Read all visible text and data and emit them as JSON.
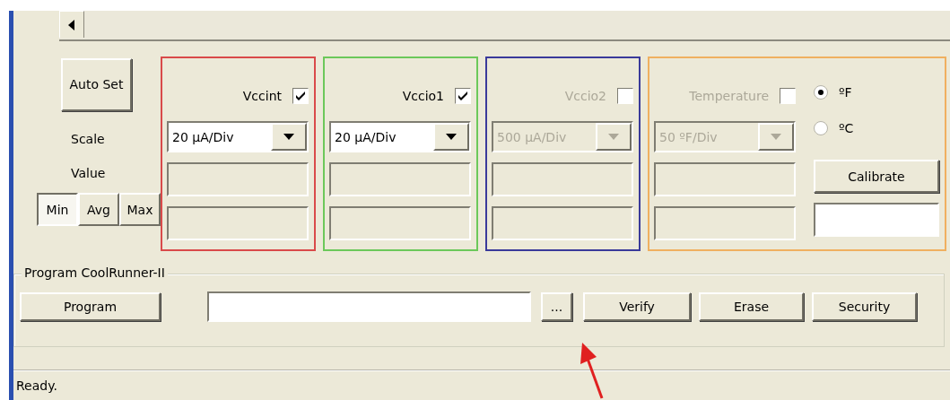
{
  "auto_set_button": "Auto Set",
  "row_labels": [
    "Scale",
    "Value"
  ],
  "stat_buttons": [
    {
      "label": "Min",
      "selected": true
    },
    {
      "label": "Avg",
      "selected": false
    },
    {
      "label": "Max",
      "selected": false
    }
  ],
  "channels": [
    {
      "label": "Vccint",
      "checked": true,
      "disabled": false,
      "color": "#d94a4a",
      "scale": "20 µA/Div"
    },
    {
      "label": "Vccio1",
      "checked": true,
      "disabled": false,
      "color": "#6cc85a",
      "scale": "20 µA/Div"
    },
    {
      "label": "Vccio2",
      "checked": false,
      "disabled": true,
      "color": "#3a3a9a",
      "scale": "500 µA/Div"
    },
    {
      "label": "Temperature",
      "checked": false,
      "disabled": true,
      "color": "#f0b060",
      "scale": "50 ºF/Div"
    }
  ],
  "units": [
    {
      "label": "ºF",
      "selected": true
    },
    {
      "label": "ºC",
      "selected": false
    }
  ],
  "calibrate_button": "Calibrate",
  "program_group": {
    "title": "Program CoolRunner-II",
    "program_button": "Program",
    "browse_button": "...",
    "buttons": [
      "Verify",
      "Erase",
      "Security"
    ]
  },
  "status_bar": "Ready."
}
